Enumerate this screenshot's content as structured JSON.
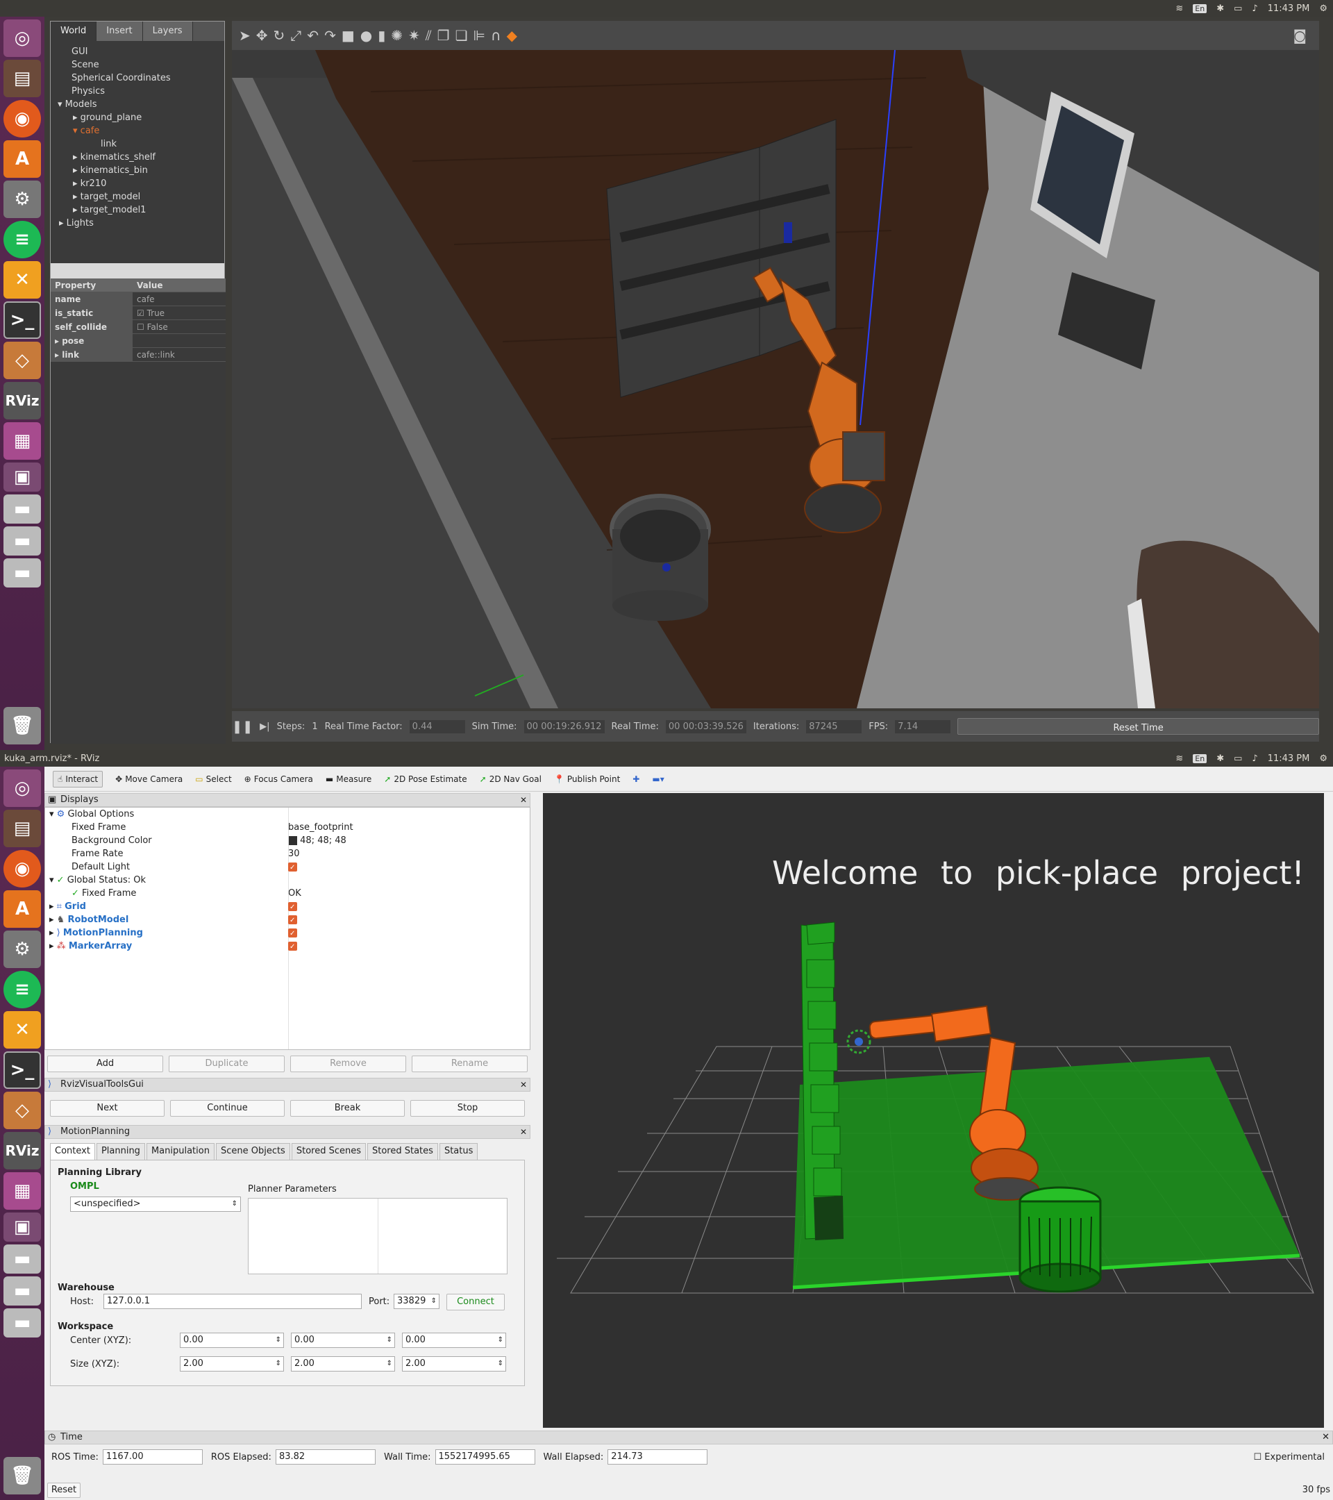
{
  "system": {
    "time": "11:43 PM",
    "lang": "En"
  },
  "gazebo": {
    "tabs": [
      "World",
      "Insert",
      "Layers"
    ],
    "tree": [
      "GUI",
      "Scene",
      "Spherical Coordinates",
      "Physics",
      "Models",
      "ground_plane",
      "cafe",
      "link",
      "kinematics_shelf",
      "kinematics_bin",
      "kr210",
      "target_model",
      "target_model1",
      "Lights"
    ],
    "prop_header": {
      "k": "Property",
      "v": "Value"
    },
    "props": [
      {
        "k": "name",
        "v": "cafe"
      },
      {
        "k": "is_static",
        "v": "True"
      },
      {
        "k": "self_collide",
        "v": "False"
      },
      {
        "k": "pose",
        "v": ""
      },
      {
        "k": "link",
        "v": "cafe::link"
      }
    ],
    "bottom": {
      "steps_label": "Steps:",
      "steps": "1",
      "rtf_label": "Real Time Factor:",
      "rtf": "0.44",
      "sim_label": "Sim Time:",
      "sim": "00 00:19:26.912",
      "real_label": "Real Time:",
      "real": "00 00:03:39.526",
      "iter_label": "Iterations:",
      "iter": "87245",
      "fps_label": "FPS:",
      "fps": "7.14",
      "reset": "Reset Time"
    }
  },
  "rviz": {
    "title": "kuka_arm.rviz* - RViz",
    "tools": [
      "Interact",
      "Move Camera",
      "Select",
      "Focus Camera",
      "Measure",
      "2D Pose Estimate",
      "2D Nav Goal",
      "Publish Point"
    ],
    "displays_title": "Displays",
    "rows": [
      {
        "n": "Global Options",
        "v": ""
      },
      {
        "n": "Fixed Frame",
        "v": "base_footprint"
      },
      {
        "n": "Background Color",
        "v": "48; 48; 48"
      },
      {
        "n": "Frame Rate",
        "v": "30"
      },
      {
        "n": "Default Light",
        "v": ""
      },
      {
        "n": "Global Status: Ok",
        "v": ""
      },
      {
        "n": "Fixed Frame",
        "v": "OK"
      },
      {
        "n": "Grid",
        "v": ""
      },
      {
        "n": "RobotModel",
        "v": ""
      },
      {
        "n": "MotionPlanning",
        "v": ""
      },
      {
        "n": "MarkerArray",
        "v": ""
      }
    ],
    "disp_buttons": [
      "Add",
      "Duplicate",
      "Remove",
      "Rename"
    ],
    "vt_title": "RvizVisualToolsGui",
    "vt_buttons": [
      "Next",
      "Continue",
      "Break",
      "Stop"
    ],
    "mp_title": "MotionPlanning",
    "mp_tabs": [
      "Context",
      "Planning",
      "Manipulation",
      "Scene Objects",
      "Stored Scenes",
      "Stored States",
      "Status"
    ],
    "planning_library": "Planning Library",
    "ompl": "OMPL",
    "planner": "<unspecified>",
    "planner_params": "Planner Parameters",
    "warehouse": "Warehouse",
    "host_label": "Host:",
    "host": "127.0.0.1",
    "port_label": "Port:",
    "port": "33829",
    "connect": "Connect",
    "workspace": "Workspace",
    "center_label": "Center (XYZ):",
    "center": [
      "0.00",
      "0.00",
      "0.00"
    ],
    "size_label": "Size (XYZ):",
    "size": [
      "2.00",
      "2.00",
      "2.00"
    ],
    "welcome": "Welcome to pick-place project!",
    "time_title": "Time",
    "ros_time_label": "ROS Time:",
    "ros_time": "1167.00",
    "ros_elapsed_label": "ROS Elapsed:",
    "ros_elapsed": "83.82",
    "wall_time_label": "Wall Time:",
    "wall_time": "1552174995.65",
    "wall_elapsed_label": "Wall Elapsed:",
    "wall_elapsed": "214.73",
    "experimental": "Experimental",
    "reset": "Reset",
    "fps": "30 fps"
  }
}
